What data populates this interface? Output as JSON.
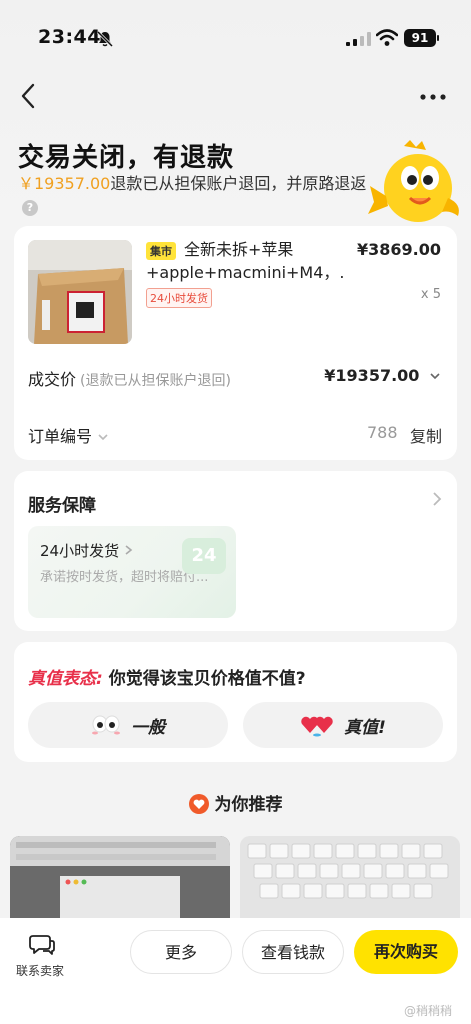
{
  "status_bar": {
    "time": "23:44",
    "battery": "91"
  },
  "header": {
    "title": "交易关闭，有退款",
    "refund_amount": "￥19357.00",
    "refund_text": "退款已从担保账户退回，并原路退返",
    "help": "?"
  },
  "order": {
    "market_tag": "集市",
    "product_title": "全新未拆+苹果+apple+macmini+M4，...",
    "ship_tag": "24小时发货",
    "unit_price": "¥3869.00",
    "quantity": "x 5",
    "deal_label": "成交价",
    "deal_note": "(退款已从担保账户退回)",
    "deal_price": "¥19357.00",
    "order_no_label": "订单编号",
    "order_no_tail": "788",
    "copy_label": "复制"
  },
  "service": {
    "title": "服务保障",
    "item_title": "24小时发货",
    "item_desc": "承诺按时发货，超时将赔付...",
    "badge": "24"
  },
  "value": {
    "title_highlight": "真值表态:",
    "question": "你觉得该宝贝价格值不值?",
    "normal_label": "一般",
    "worth_label": "真值!"
  },
  "recommend": {
    "title": "为你推荐"
  },
  "bottom_bar": {
    "contact_label": "联系卖家",
    "more_label": "更多",
    "wallet_label": "查看钱款",
    "rebuy_label": "再次购买"
  },
  "watermark": "@稍稍稍",
  "colors": {
    "accent_yellow": "#ffe200",
    "refund_orange": "#f0a020",
    "hl_red": "#e8304a"
  }
}
